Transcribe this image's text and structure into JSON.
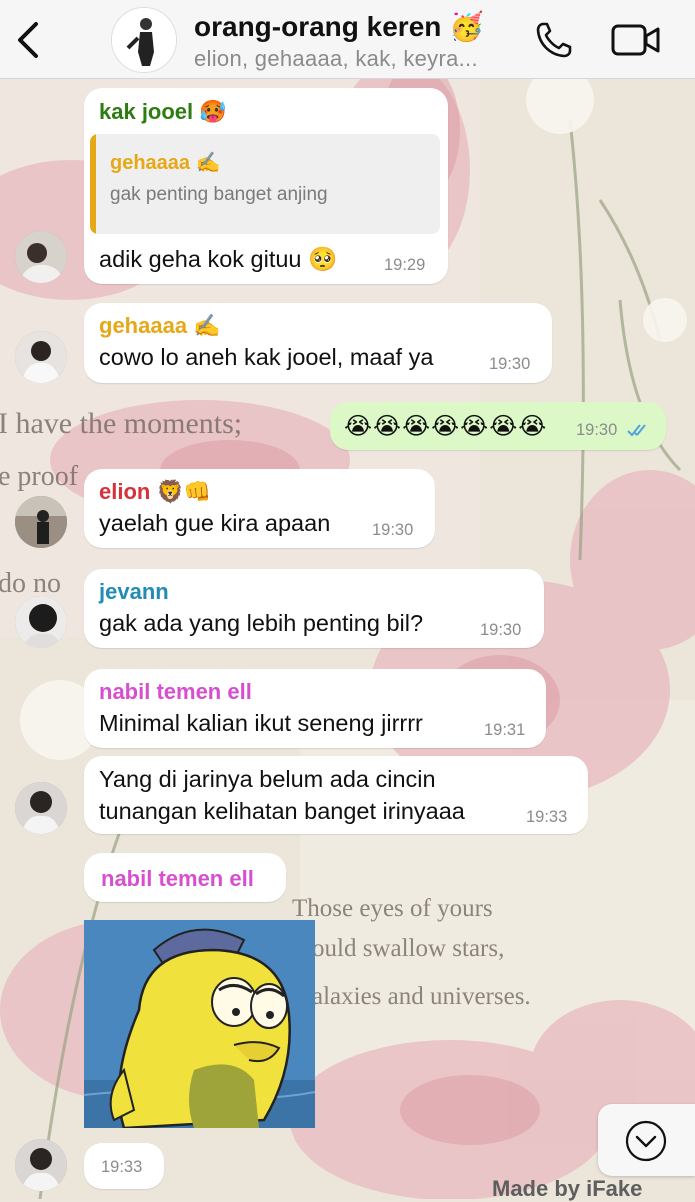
{
  "header": {
    "back_label": "<",
    "title": "orang-orang keren 🥳",
    "members": "elion, gehaaaa, kak, keyra..."
  },
  "messages": [
    {
      "sender": "kak jooel 🥵",
      "sender_color": "#2e7d12",
      "reply": {
        "sender": "gehaaaa ✍️",
        "sender_color": "#e6a817",
        "text": "gak penting banget anjing"
      },
      "text": "adik geha kok gituu 🥺",
      "time": "19:29"
    },
    {
      "sender": "gehaaaa ✍️",
      "sender_color": "#e6a817",
      "text": "cowo lo aneh kak jooel, maaf ya",
      "time": "19:30"
    },
    {
      "outgoing": true,
      "text": "😭😭😭😭😭😭😭",
      "time": "19:30",
      "read_icon": "double-check-icon"
    },
    {
      "sender": "elion 🦁👊",
      "sender_color": "#d6323a",
      "text": "yaelah gue kira apaan",
      "time": "19:30"
    },
    {
      "sender": "jevann",
      "sender_color": "#1f8db5",
      "text": "gak ada yang lebih penting bil?",
      "time": "19:30"
    },
    {
      "sender": "nabil temen ell",
      "sender_color": "#d64fd0",
      "text": "Minimal kalian ikut seneng jirrrr",
      "time": "19:31"
    },
    {
      "text_line1": "Yang di jarinya belum ada cincin",
      "text_line2": "tunangan kelihatan banget irinyaaa",
      "time": "19:33"
    },
    {
      "sender": "nabil temen ell",
      "sender_color": "#d64fd0",
      "sticker": "sad-fish-sticker",
      "time": "19:33"
    }
  ],
  "wallpaper_text": {
    "line1": "I have the moments;",
    "line2": "e proof",
    "line3": "do no",
    "quote1": "Those eyes of yours",
    "quote2": "ould swallow stars,",
    "quote3": "alaxies and universes."
  },
  "scroll_icon": "chevron-down-circle-icon",
  "watermark": "Made by iFake",
  "colors": {
    "header_bg": "#f6f6f6",
    "incoming_bubble": "#ffffff",
    "outgoing_bubble": "#dcf8c6",
    "read_ticks": "#4fa3e0"
  }
}
